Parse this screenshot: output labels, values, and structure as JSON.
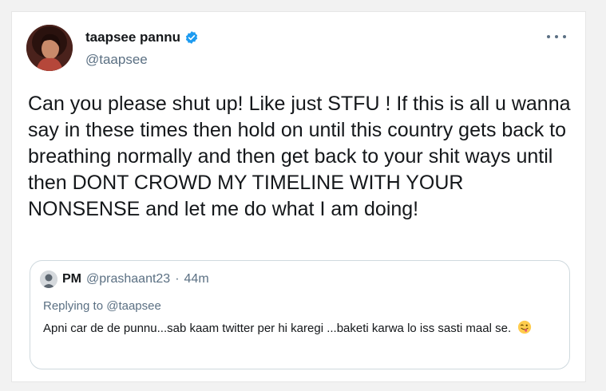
{
  "tweet": {
    "display_name": "taapsee pannu",
    "handle": "@taapsee",
    "text": "Can you please shut up! Like just STFU ! If this is all u wanna say in these times then hold on until this country gets back to breathing normally and then get back to your shit ways until then DONT CROWD MY TIMELINE WITH YOUR NONSENSE and let me do what I am doing!",
    "verified_icon": "verified-badge-icon",
    "more_icon": "more-options-icon"
  },
  "quoted": {
    "display_name": "PM",
    "handle": "@prashaant23",
    "separator": "·",
    "time": "44m",
    "replying_prefix": "Replying to",
    "replying_to": "@taapsee",
    "text": "Apni car de de punnu...sab kaam twitter per hi karegi ...baketi karwa lo iss sasti maal se.",
    "emoji_icon": "winking-face-with-tongue-emoji"
  },
  "colors": {
    "verified": "#1d9bf0",
    "secondary_text": "#5b7083",
    "primary_text": "#14171a",
    "border": "#cfd9de"
  }
}
